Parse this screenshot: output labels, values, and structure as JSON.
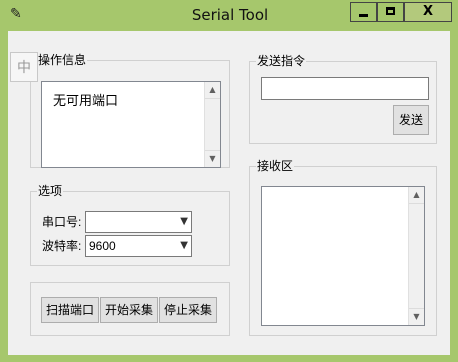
{
  "window": {
    "title": "Serial Tool",
    "min_glyph": "",
    "close_glyph": "X"
  },
  "ime": {
    "label": "中"
  },
  "log_group": {
    "legend": "操作信息",
    "message": "无可用端口"
  },
  "send_group": {
    "legend": "发送指令",
    "input_value": "",
    "send_label": "发送"
  },
  "options_group": {
    "legend": "选项",
    "port_label": "串口号:",
    "port_value": "",
    "baud_label": "波特率:",
    "baud_value": "9600"
  },
  "receive_group": {
    "legend": "接收区"
  },
  "actions": {
    "scan_label": "扫描端口",
    "start_label": "开始采集",
    "stop_label": "停止采集"
  },
  "colors": {
    "frame": "#a6c76c",
    "client": "#f0f0f0"
  }
}
